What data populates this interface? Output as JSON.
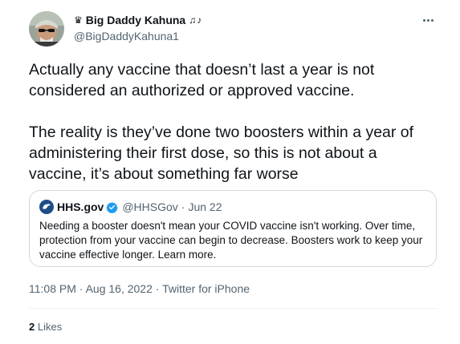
{
  "author": {
    "display_name": "Big Daddy Kahuna",
    "crown_glyph": "♛",
    "notes_glyph": "♫♪",
    "handle": "@BigDaddyKahuna1"
  },
  "tweet": {
    "text": "Actually any vaccine that doesn’t last a year is not considered an authorized or approved vaccine.\n\nThe reality is they’ve done two boosters within a year of administering their first dose, so this is not about a vaccine, it’s about something far worse"
  },
  "quoted_tweet": {
    "name": "HHS.gov",
    "handle": "@HHSGov",
    "separator": "·",
    "date": "Jun 22",
    "text": "Needing a booster doesn't mean your COVID vaccine isn't working. Over time, protection from your vaccine can begin to decrease. Boosters work to keep your vaccine effective longer. Learn more."
  },
  "meta": {
    "time": "11:08 PM",
    "separator": "·",
    "date": "Aug 16, 2022",
    "source": "Twitter for iPhone"
  },
  "stats": {
    "likes_count": "2",
    "likes_label": "Likes"
  },
  "colors": {
    "text": "#0f1419",
    "secondary": "#536471",
    "border": "#cfd9de",
    "verified": "#1d9bf0"
  }
}
